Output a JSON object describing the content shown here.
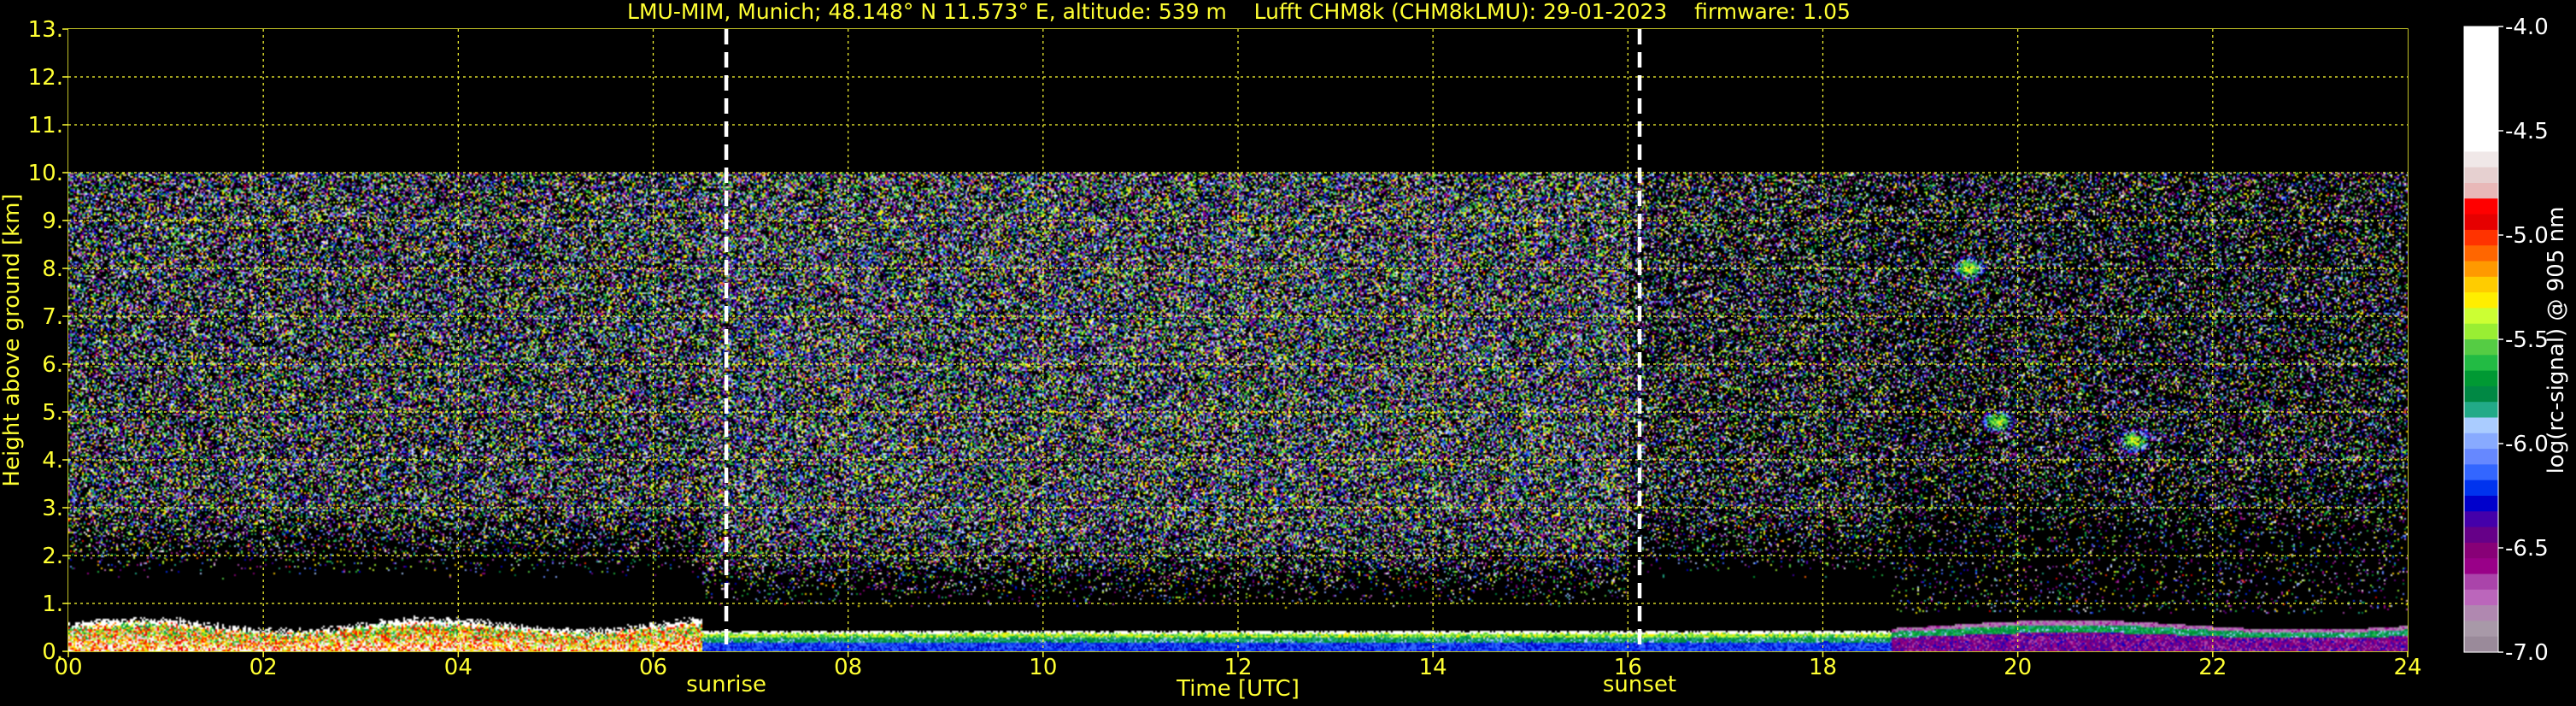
{
  "chart_data": {
    "type": "heatmap",
    "title": "LMU-MIM, Munich; 48.148° N 11.573° E, altitude: 539 m    Lufft CHM8k (CHM8kLMU): 29-01-2023    firmware: 1.05",
    "xlabel": "Time [UTC]",
    "ylabel": "Height above ground [km]",
    "xlim": [
      0,
      24
    ],
    "ylim": [
      0,
      13
    ],
    "x_ticks": [
      "00",
      "02",
      "04",
      "06",
      "08",
      "10",
      "12",
      "14",
      "16",
      "18",
      "20",
      "22",
      "24"
    ],
    "y_ticks": [
      "0.",
      "1.",
      "2.",
      "3.",
      "4.",
      "5.",
      "6.",
      "7.",
      "8.",
      "9.",
      "10.",
      "11.",
      "12.",
      "13."
    ],
    "grid": true,
    "markers": [
      {
        "label": "sunrise",
        "x": 6.75
      },
      {
        "label": "sunset",
        "x": 16.12
      }
    ],
    "data_top_km": 10,
    "colorbar": {
      "label": "log(rc-signal) @ 905 nm",
      "range": [
        -7.0,
        -4.0
      ],
      "ticks": [
        "-4.0",
        "-4.5",
        "-5.0",
        "-5.5",
        "-6.0",
        "-6.5",
        "-7.0"
      ],
      "colors": [
        "#ffffff",
        "#ffffff",
        "#ffffff",
        "#ffffff",
        "#ffffff",
        "#ffffff",
        "#ffffff",
        "#ffffff",
        "#f0e8e8",
        "#e6d0d0",
        "#e8b8b8",
        "#ff0000",
        "#e60000",
        "#ff3300",
        "#ff6600",
        "#ff9900",
        "#ffcc00",
        "#ffee00",
        "#ccff33",
        "#99ee33",
        "#55cc44",
        "#22bb44",
        "#009933",
        "#008844",
        "#22aa88",
        "#aaccff",
        "#88aaff",
        "#6688ff",
        "#3366ff",
        "#0033ee",
        "#0000cc",
        "#4400aa",
        "#660088",
        "#880077",
        "#990088",
        "#aa44aa",
        "#bb66bb",
        "#b088b0",
        "#a899a8",
        "#9a8a9a"
      ]
    },
    "layers": [
      {
        "name": "noise",
        "x_range": [
          0,
          24
        ],
        "y_range": [
          0.3,
          10
        ]
      },
      {
        "name": "boundary-layer",
        "x_range": [
          0,
          24
        ],
        "y_range": [
          0,
          0.8
        ]
      },
      {
        "name": "cloud",
        "x": 19.5,
        "y": 8.0
      },
      {
        "name": "cloud",
        "x": 21.2,
        "y": 4.4
      },
      {
        "name": "cloud",
        "x": 19.8,
        "y": 4.8
      }
    ]
  }
}
